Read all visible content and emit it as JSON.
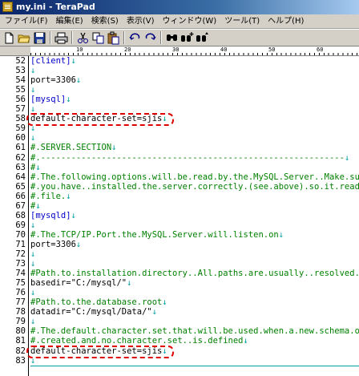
{
  "window": {
    "title": "my.ini - TeraPad"
  },
  "menubar": {
    "items": [
      "ファイル(F)",
      "編集(E)",
      "検索(S)",
      "表示(V)",
      "ウィンドウ(W)",
      "ツール(T)",
      "ヘルプ(H)"
    ]
  },
  "toolbar": {
    "buttons": [
      "new-file-icon",
      "open-file-icon",
      "save-file-icon",
      "print-icon",
      "cut-icon",
      "copy-icon",
      "paste-icon",
      "undo-icon",
      "redo-icon",
      "find-icon",
      "find-next-icon",
      "replace-icon"
    ]
  },
  "ruler": {
    "marks": [
      "10",
      "20",
      "30",
      "40",
      "50",
      "60"
    ]
  },
  "editor": {
    "eol_mark": "↓",
    "lines": [
      {
        "num": "52",
        "text": "[client]",
        "kind": "bracket"
      },
      {
        "num": "53",
        "text": "",
        "kind": "plain"
      },
      {
        "num": "54",
        "text": "port=3306",
        "kind": "plain"
      },
      {
        "num": "55",
        "text": "",
        "kind": "plain"
      },
      {
        "num": "56",
        "text": "[mysql]",
        "kind": "bracket"
      },
      {
        "num": "57",
        "text": "",
        "kind": "plain"
      },
      {
        "num": "58",
        "text": "default-character-set=sjis",
        "kind": "plain",
        "highlight": true
      },
      {
        "num": "59",
        "text": "",
        "kind": "plain"
      },
      {
        "num": "60",
        "text": "",
        "kind": "plain"
      },
      {
        "num": "61",
        "text": "#.SERVER.SECTION",
        "kind": "comment"
      },
      {
        "num": "62",
        "text": "#.------------------------------------------------------------",
        "kind": "comment"
      },
      {
        "num": "63",
        "text": "#",
        "kind": "comment"
      },
      {
        "num": "64",
        "text": "#.The.following.options.will.be.read.by.the.MySQL.Server..Make.su",
        "kind": "comment",
        "noeol": true
      },
      {
        "num": "65",
        "text": "#.you.have..installed.the.server.correctly.(see.above).so.it.reads",
        "kind": "comment",
        "noeol": true
      },
      {
        "num": "66",
        "text": "#.file.",
        "kind": "comment"
      },
      {
        "num": "67",
        "text": "#",
        "kind": "comment"
      },
      {
        "num": "68",
        "text": "[mysqld]",
        "kind": "bracket"
      },
      {
        "num": "69",
        "text": "",
        "kind": "plain"
      },
      {
        "num": "70",
        "text": "#.The.TCP/IP.Port.the.MySQL.Server.will.listen.on",
        "kind": "comment"
      },
      {
        "num": "71",
        "text": "port=3306",
        "kind": "plain"
      },
      {
        "num": "72",
        "text": "",
        "kind": "plain"
      },
      {
        "num": "73",
        "text": "",
        "kind": "plain"
      },
      {
        "num": "74",
        "text": "#Path.to.installation.directory..All.paths.are.usually..resolved.r",
        "kind": "comment",
        "noeol": true
      },
      {
        "num": "75",
        "text": "basedir=\"C:/mysql/\"",
        "kind": "plain"
      },
      {
        "num": "76",
        "text": "",
        "kind": "plain"
      },
      {
        "num": "77",
        "text": "#Path.to.the.database.root",
        "kind": "comment"
      },
      {
        "num": "78",
        "text": "datadir=\"C:/mysql/Data/\"",
        "kind": "plain"
      },
      {
        "num": "79",
        "text": "",
        "kind": "plain"
      },
      {
        "num": "80",
        "text": "#.The.default.character.set.that.will.be.used.when.a.new.schema.o",
        "kind": "comment",
        "noeol": true
      },
      {
        "num": "81",
        "text": "#.created.and.no.character.set..is.defined",
        "kind": "comment"
      },
      {
        "num": "82",
        "text": "default-character-set=sjis",
        "kind": "plain",
        "highlight": true
      },
      {
        "num": "83",
        "text": "",
        "kind": "plain"
      }
    ]
  }
}
